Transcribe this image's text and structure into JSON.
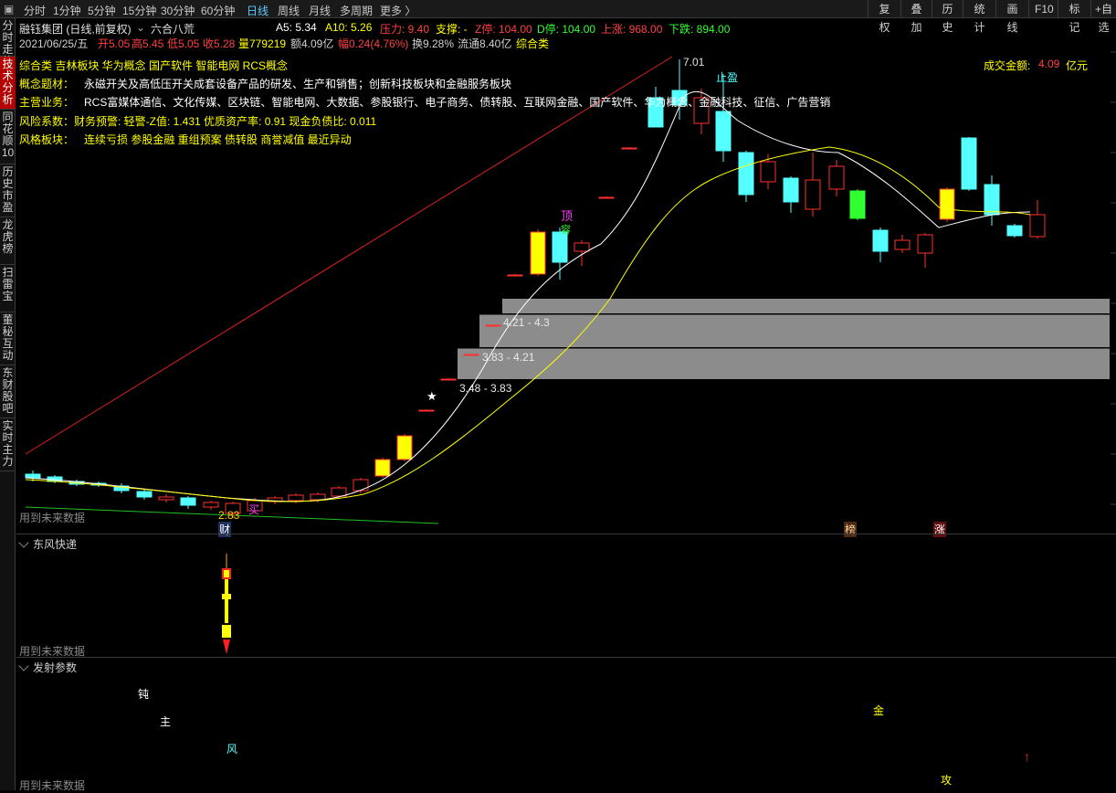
{
  "toolbar": {
    "tabs": [
      "分时",
      "1分钟",
      "5分钟",
      "15分钟",
      "30分钟",
      "60分钟",
      "日线",
      "周线",
      "月线",
      "多周期",
      "更多 〉"
    ],
    "right": [
      "复权",
      "叠加",
      "历史",
      "统计",
      "画线",
      "F10",
      "标记",
      "+自选"
    ]
  },
  "sidebar": [
    "分时走势",
    "技术分析",
    "同花顺10",
    "历史市盈",
    "龙虎榜",
    "扫雷宝",
    "董秘互动",
    "东财股吧",
    "实时主力"
  ],
  "header": {
    "stock": "融钰集团 (日线,前复权)",
    "indicator": "六合八荒",
    "a5": "A5: 5.34",
    "a10": "A10: 5.26",
    "pressure": "压力: 9.40",
    "support": "支撑: -",
    "zt": "Z停: 104.00",
    "dt": "D停: 104.00",
    "up": "上涨: 968.00",
    "down": "下跌: 894.00"
  },
  "quote": {
    "date": "2021/06/25/五",
    "open": "开5.05",
    "high": "高5.45",
    "low": "低5.05",
    "close": "收5.28",
    "vol": "量779219",
    "amt": "额4.09亿",
    "chg": "幅0.24(4.76%)",
    "turn": "换9.28%",
    "float": "流通8.40亿",
    "cls": "综合类"
  },
  "info": {
    "sectors": "综合类  吉林板块  华为概念  国产软件  智能电网  RCS概念",
    "concept_label": "概念题材：",
    "concept": "永磁开关及高低压开关成套设备产品的研发、生产和销售；创新科技板块和金融服务板块",
    "business_label": "主营业务：",
    "business": "RCS富媒体通信、文化传媒、区块链、智能电网、大数据、参股银行、电子商务、债转股、互联网金融、国产软件、华为概念、金融科技、征信、广告营销",
    "risk": "风险系数：财务预警: 轻警-Z值: 1.431 优质资产率: 0.91 现金负债比: 0.011",
    "style_label": "风格板块：",
    "style": "连续亏损  参股金融  重组预案  债转股  商誉减值  最近异动"
  },
  "amount": {
    "label": "成交金额:",
    "value": "4.09",
    "unit": "亿元"
  },
  "chart_labels": {
    "peak": "7.01",
    "top": "顶",
    "top2": "容",
    "star": "★",
    "zone1": "4.21 - 4.3",
    "zone2": "3.83 - 4.21",
    "zone3": "3.48 - 3.83",
    "cai": "财",
    "bang": "榜",
    "zhang": "涨",
    "low_tag": "2.83",
    "buy": "买",
    "zhiying": "止盈"
  },
  "future": "用到未来数据",
  "panel2": {
    "title": "东风快递"
  },
  "panel3": {
    "title": "发射参数",
    "labels": {
      "dun": "钝",
      "zhu": "主",
      "feng": "风",
      "jin": "金",
      "gong": "攻"
    }
  },
  "colors": {
    "up": "#ff3030",
    "down": "#54ffff",
    "yellow": "#ffff00",
    "ma": "#ffffff"
  }
}
